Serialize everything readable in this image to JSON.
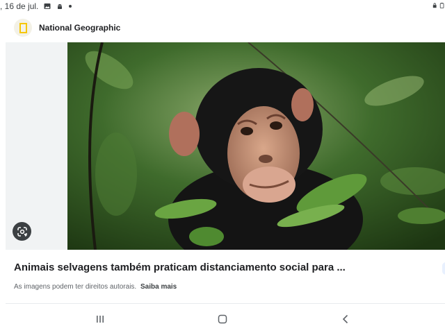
{
  "status_bar": {
    "date_text": ", 16 de jul.",
    "icons": [
      "image-icon",
      "android-icon",
      "dot-icon",
      "battery-icon"
    ]
  },
  "card": {
    "source": {
      "name": "National Geographic",
      "logo_icon": "national-geographic-logo",
      "logo_color": "#f6c600"
    },
    "image": {
      "subject": "chimpanzee among leaves",
      "lens_icon": "google-lens-icon"
    },
    "title": "Animais selvagens também praticam distanciamento social para ...",
    "copyright": {
      "text": "As imagens podem ter direitos autorais.",
      "learn_more": "Saiba mais"
    }
  },
  "nav_bar": {
    "buttons": [
      "recent-apps-icon",
      "home-icon",
      "back-icon"
    ]
  }
}
